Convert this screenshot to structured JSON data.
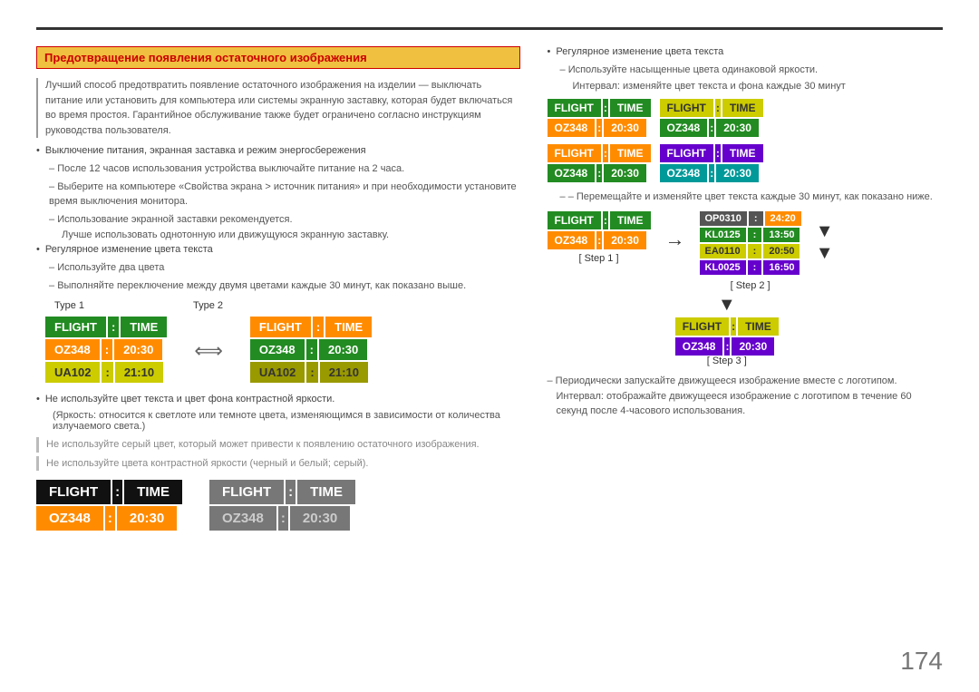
{
  "page": {
    "number": "174",
    "title": "Предотвращение появления остаточного изображения"
  },
  "left": {
    "intro": "Лучший способ предотвратить появление остаточного изображения на изделии — выключать питание или установить для компьютера или системы экранную заставку, которая будет включаться во время простоя. Гарантийное обслуживание также будет ограничено согласно инструкциям руководства пользователя.",
    "bullet1": {
      "text": "Выключение питания, экранная заставка и режим энергосбережения",
      "sub1": "После 12 часов использования устройства выключайте питание на 2 часа.",
      "sub2": "Выберите на компьютере «Свойства экрана > источник питания» и при необходимости установите время выключения монитора.",
      "sub3": "Использование экранной заставки рекомендуется.",
      "sub4": "Лучше использовать однотонную или движущуюся экранную заставку."
    },
    "bullet2": {
      "text": "Регулярное изменение цвета текста",
      "sub1": "Используйте два цвета",
      "sub2": "Выполняйте переключение между двумя цветами каждые 30 минут, как показано выше."
    },
    "type1_label": "Type 1",
    "type2_label": "Type 2",
    "flight_word": "FLIGHT",
    "time_word": "TIME",
    "sep": ":",
    "type1": {
      "row1": [
        "FLIGHT",
        ":",
        "TIME"
      ],
      "row2": [
        "OZ348",
        ":",
        "20:30"
      ],
      "row3": [
        "UA102",
        ":",
        "21:10"
      ]
    },
    "type2": {
      "row1": [
        "FLIGHT",
        ":",
        "TIME"
      ],
      "row2": [
        "OZ348",
        ":",
        "20:30"
      ],
      "row3": [
        "UA102",
        ":",
        "21:10"
      ]
    },
    "bullet3": {
      "text": "Не используйте цвет текста и цвет фона контрастной яркости.",
      "sub1": "(Яркость: относится к светлоте или темноте цвета, изменяющимся в зависимости от количества излучаемого света.)"
    },
    "note1": "Не используйте серый цвет, который может привести к появлению остаточного изображения.",
    "note2": "Не используйте цвета контрастной яркости (черный и белый; серый).",
    "bottom_board1": {
      "header": [
        "FLIGHT",
        ":",
        "TIME"
      ],
      "data": [
        "OZ348",
        ":",
        "20:30"
      ]
    },
    "bottom_board2": {
      "header": [
        "FLIGHT",
        ":",
        "TIME"
      ],
      "data": [
        "OZ348",
        ":",
        "20:30"
      ]
    }
  },
  "right": {
    "bullet1": "Регулярное изменение цвета текста",
    "sub1": "Используйте насыщенные цвета одинаковой яркости.",
    "sub2": "Интервал: изменяйте цвет текста и фона каждые 30 минут",
    "boards_row1": [
      {
        "header": [
          "FLIGHT",
          ":",
          "TIME"
        ],
        "data": [
          "OZ348",
          ":",
          "20:30"
        ],
        "hbg": [
          "#228B22",
          "#228B22"
        ],
        "dbg": [
          "#FF8C00",
          "#FF8C00"
        ]
      },
      {
        "header": [
          "FLIGHT",
          ":",
          "TIME"
        ],
        "data": [
          "OZ348",
          ":",
          "20:30"
        ],
        "hbg": [
          "#cccc00",
          "#cccc00"
        ],
        "dbg": [
          "#228B22",
          "#228B22"
        ]
      }
    ],
    "boards_row2": [
      {
        "header": [
          "FLIGHT",
          ":",
          "TIME"
        ],
        "data": [
          "OZ348",
          ":",
          "20:30"
        ],
        "hbg": [
          "#FF8C00",
          "#FF8C00"
        ],
        "dbg": [
          "#228B22",
          "#228B22"
        ]
      },
      {
        "header": [
          "FLIGHT",
          ":",
          "TIME"
        ],
        "data": [
          "OZ348",
          ":",
          "20:30"
        ],
        "hbg": [
          "#6600cc",
          "#6600cc"
        ],
        "dbg": [
          "#009999",
          "#009999"
        ]
      }
    ],
    "step_note": "– Перемещайте и изменяйте цвет текста каждые 30 минут, как показано ниже.",
    "step1_label": "[ Step 1 ]",
    "step2_label": "[ Step 2 ]",
    "step3_label": "[ Step 3 ]",
    "step1_board": {
      "header": [
        "FLIGHT",
        ":",
        "TIME"
      ],
      "data": [
        "OZ348",
        ":",
        "20:30"
      ]
    },
    "step2_multi": [
      [
        "OP0310",
        ":",
        "24:20"
      ],
      [
        "KL0125",
        ":",
        "13:50"
      ],
      [
        "EA0110",
        ":",
        "20:50"
      ],
      [
        "KL0025",
        ":",
        "16:50"
      ]
    ],
    "step3_board": {
      "header": [
        "FLIGHT",
        ":",
        "TIME"
      ],
      "data": [
        "OZ348",
        ":",
        "20:30"
      ]
    },
    "periodic_note1": "– Периодически запускайте движущееся изображение вместе с логотипом.",
    "periodic_note2": "Интервал: отображайте движущееся изображение с логотипом в течение 60 секунд после 4-часового использования."
  }
}
